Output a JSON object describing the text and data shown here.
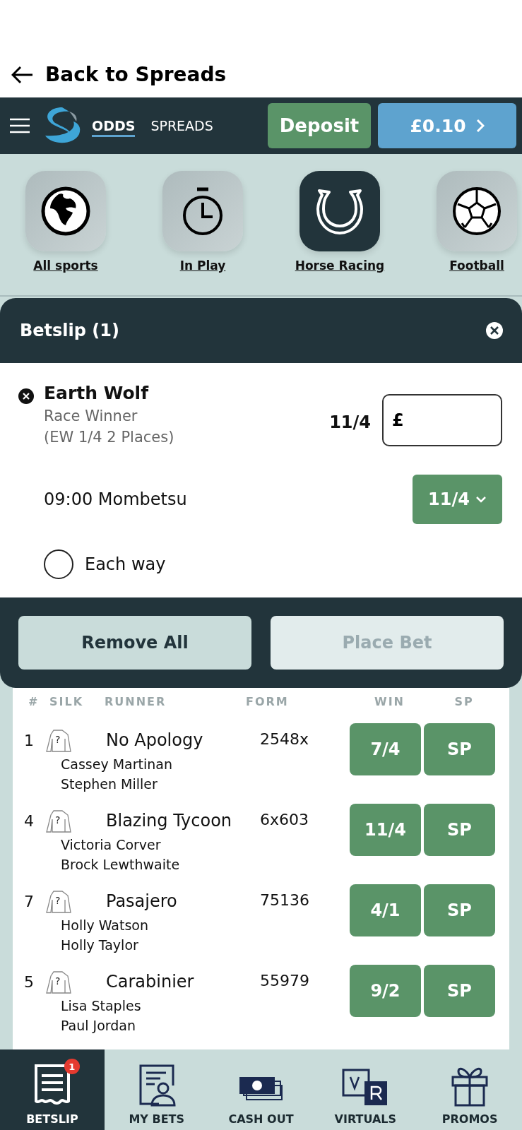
{
  "back_link": {
    "label": "Back to Spreads"
  },
  "top_bar": {
    "tabs": [
      {
        "label": "ODDS",
        "selected": true
      },
      {
        "label": "SPREADS",
        "selected": false
      }
    ],
    "deposit": "Deposit",
    "balance": "£0.10"
  },
  "sports": [
    {
      "label": "All sports",
      "selected": false
    },
    {
      "label": "In Play",
      "selected": false
    },
    {
      "label": "Horse Racing",
      "selected": true
    },
    {
      "label": "Football",
      "selected": false
    }
  ],
  "betslip": {
    "title": "Betslip (1)",
    "selection": {
      "name": "Earth Wolf",
      "market": "Race Winner",
      "terms": "(EW 1/4 2 Places)",
      "odds": "11/4",
      "stake_prefix": "£",
      "event": "09:00 Mombetsu",
      "price": "11/4"
    },
    "each_way": {
      "label": "Each way",
      "checked": false
    },
    "remove_all": "Remove All",
    "place_bet": {
      "label": "Place Bet",
      "disabled": true
    }
  },
  "table": {
    "columns": [
      "#",
      "SILK",
      "RUNNER",
      "FORM",
      "WIN",
      "SP"
    ],
    "rows": [
      {
        "number": "1",
        "silk": "?",
        "runner": "No Apology",
        "trainer": "Cassey Martinan",
        "jockey": "Stephen Miller",
        "form": "2548x",
        "win": "7/4",
        "sp": "SP"
      },
      {
        "number": "4",
        "silk": "?",
        "runner": "Blazing Tycoon",
        "trainer": "Victoria Corver",
        "jockey": "Brock Lewthwaite",
        "form": "6x603",
        "win": "11/4",
        "sp": "SP"
      },
      {
        "number": "7",
        "silk": "?",
        "runner": "Pasajero",
        "trainer": "Holly Watson",
        "jockey": "Holly Taylor",
        "form": "75136",
        "win": "4/1",
        "sp": "SP"
      },
      {
        "number": "5",
        "silk": "?",
        "runner": "Carabinier",
        "trainer": "Lisa Staples",
        "jockey": "Paul Jordan",
        "form": "55979",
        "win": "9/2",
        "sp": "SP"
      }
    ]
  },
  "bottom_nav": [
    {
      "label": "BETSLIP",
      "selected": true,
      "badge": "1"
    },
    {
      "label": "MY BETS",
      "selected": false
    },
    {
      "label": "CASH OUT",
      "selected": false
    },
    {
      "label": "VIRTUALS",
      "selected": false
    },
    {
      "label": "PROMOS",
      "selected": false
    }
  ]
}
